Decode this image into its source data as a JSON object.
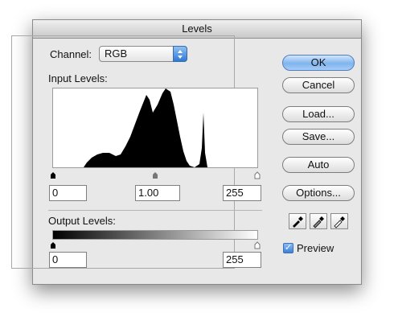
{
  "window": {
    "title": "Levels"
  },
  "channel": {
    "label": "Channel:",
    "value": "RGB"
  },
  "input_levels": {
    "label": "Input Levels:",
    "black": "0",
    "gamma": "1.00",
    "white": "255"
  },
  "output_levels": {
    "label": "Output Levels:",
    "black": "0",
    "white": "255"
  },
  "buttons": {
    "ok": "OK",
    "cancel": "Cancel",
    "load": "Load...",
    "save": "Save...",
    "auto": "Auto",
    "options": "Options..."
  },
  "preview": {
    "label": "Preview",
    "checked": true
  },
  "icons": [
    "chevron-updown-icon",
    "black-eyedropper-icon",
    "gray-eyedropper-icon",
    "white-eyedropper-icon",
    "checkmark-icon"
  ]
}
